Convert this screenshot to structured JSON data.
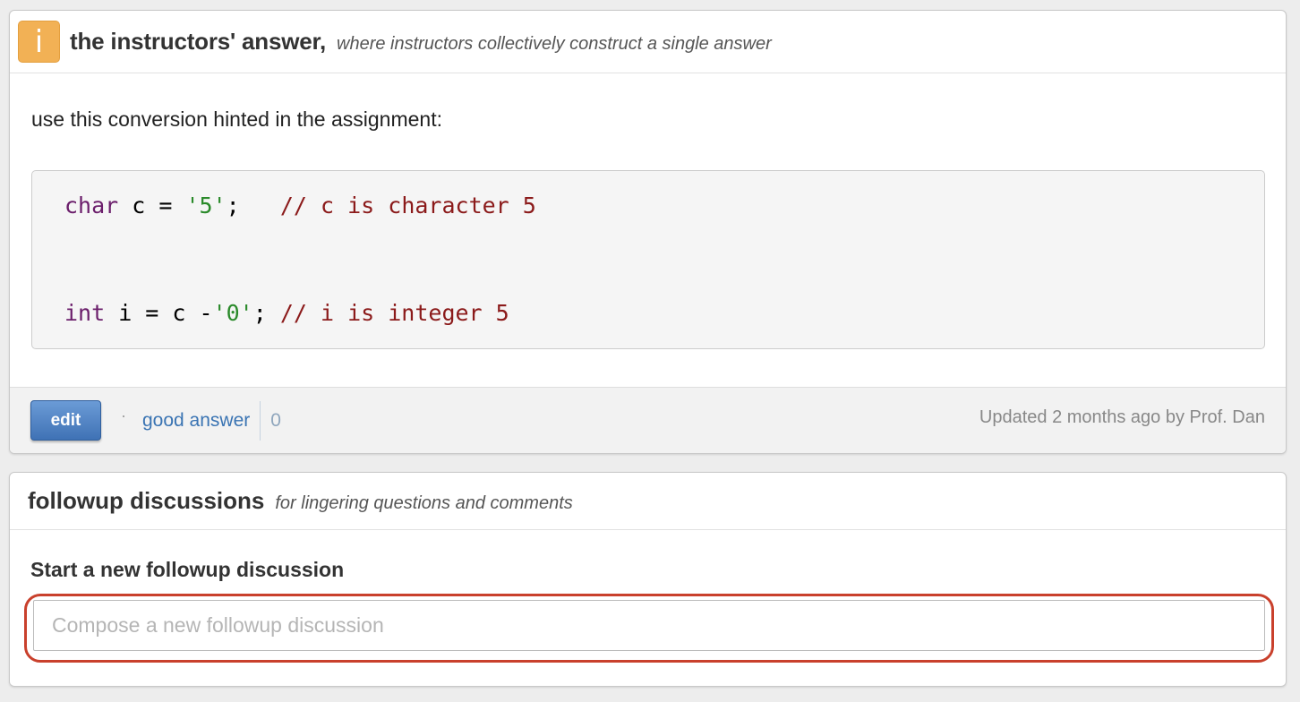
{
  "answer": {
    "badge_icon": "i",
    "title": "the instructors' answer,",
    "subtitle": "where instructors collectively construct a single answer",
    "body_text": "use this conversion hinted in the assignment:",
    "code": {
      "line1": {
        "keyword": "char",
        "mid": " c = ",
        "string": "'5'",
        "after": ";   ",
        "comment": "// c is character 5"
      },
      "line2": {
        "keyword": "int",
        "mid": " i = c -",
        "string": "'0'",
        "after": "; ",
        "comment": "// i is integer 5"
      }
    },
    "footer": {
      "edit_label": "edit",
      "separator": "·",
      "good_answer_label": "good answer",
      "good_answer_count": "0",
      "updated_text": "Updated 2 months ago by Prof. Dan"
    }
  },
  "followup": {
    "title": "followup discussions",
    "subtitle": "for lingering questions and comments",
    "start_label": "Start a new followup discussion",
    "compose_placeholder": "Compose a new followup discussion",
    "compose_value": ""
  },
  "colors": {
    "badge": "#f2b155",
    "edit_button": "#4a7fc1",
    "link": "#3a74b3",
    "highlight_outline": "#c9402c",
    "code_keyword": "#6b1e6b",
    "code_string": "#2a8a2a",
    "code_comment": "#8b1a1a"
  }
}
